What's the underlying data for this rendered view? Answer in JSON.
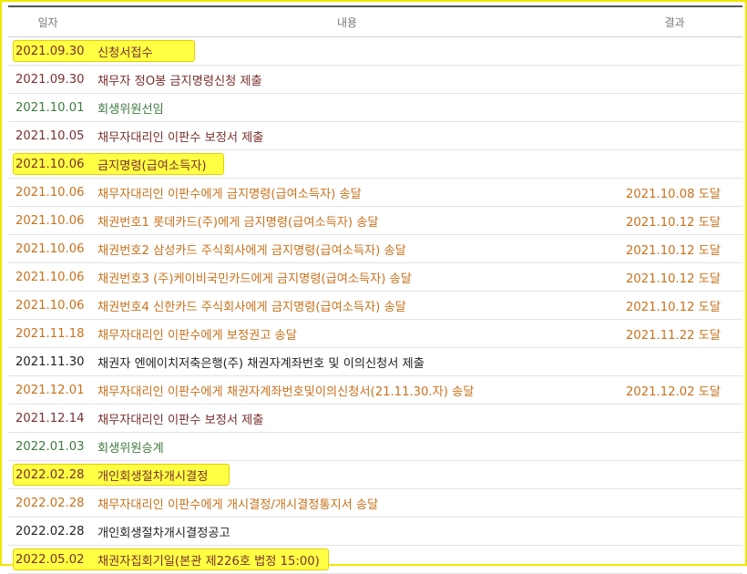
{
  "header": {
    "date": "일자",
    "content": "내용",
    "result": "결과"
  },
  "rows": [
    {
      "date": "2021.09.30",
      "content": "신청서접수",
      "result": "",
      "kind": "red",
      "hl_width": 198
    },
    {
      "date": "2021.09.30",
      "content": "채무자 정O봉 금지명령신청 제출",
      "result": "",
      "kind": "red"
    },
    {
      "date": "2021.10.01",
      "content": "회생위원선임",
      "result": "",
      "kind": "green"
    },
    {
      "date": "2021.10.05",
      "content": "채무자대리인 이판수 보정서 제출",
      "result": "",
      "kind": "red"
    },
    {
      "date": "2021.10.06",
      "content": "금지명령(급여소득자)",
      "result": "",
      "kind": "red",
      "hl_width": 230
    },
    {
      "date": "2021.10.06",
      "content": "채무자대리인 이판수에게 금지명령(급여소득자) 송달",
      "result": "2021.10.08 도달",
      "kind": "orange"
    },
    {
      "date": "2021.10.06",
      "content": "채권번호1 롯데카드(주)에게 금지명령(급여소득자) 송달",
      "result": "2021.10.12 도달",
      "kind": "orange"
    },
    {
      "date": "2021.10.06",
      "content": "채권번호2 삼성카드 주식회사에게 금지명령(급여소득자) 송달",
      "result": "2021.10.12 도달",
      "kind": "orange"
    },
    {
      "date": "2021.10.06",
      "content": "채권번호3 (주)케이비국민카드에게 금지명령(급여소득자) 송달",
      "result": "2021.10.12 도달",
      "kind": "orange"
    },
    {
      "date": "2021.10.06",
      "content": "채권번호4 신한카드 주식회사에게 금지명령(급여소득자) 송달",
      "result": "2021.10.12 도달",
      "kind": "orange"
    },
    {
      "date": "2021.11.18",
      "content": "채무자대리인 이판수에게 보정권고 송달",
      "result": "2021.11.22 도달",
      "kind": "orange"
    },
    {
      "date": "2021.11.30",
      "content": "채권자 엔에이치저축은행(주) 채권자계좌번호 및 이의신청서 제출",
      "result": "",
      "kind": "black"
    },
    {
      "date": "2021.12.01",
      "content": "채무자대리인 이판수에게 채권자계좌번호및이의신청서(21.11.30.자) 송달",
      "result": "2021.12.02 도달",
      "kind": "orange"
    },
    {
      "date": "2021.12.14",
      "content": "채무자대리인 이판수 보정서 제출",
      "result": "",
      "kind": "red"
    },
    {
      "date": "2022.01.03",
      "content": "회생위원승계",
      "result": "",
      "kind": "green"
    },
    {
      "date": "2022.02.28",
      "content": "개인회생절차개시결정",
      "result": "",
      "kind": "red",
      "hl_width": 236
    },
    {
      "date": "2022.02.28",
      "content": "채무자대리인 이판수에게 개시결정/개시결정통지서 송달",
      "result": "",
      "kind": "orange"
    },
    {
      "date": "2022.02.28",
      "content": "개인회생절차개시결정공고",
      "result": "",
      "kind": "black"
    },
    {
      "date": "2022.05.02",
      "content": "채권자집회기일(본관 제226호 법정 15:00)",
      "result": "",
      "kind": "red",
      "hl_width": 345
    }
  ],
  "colors": {
    "frame": "#f2e600",
    "highlight": "#ffff44",
    "orange": "#c8711b",
    "red": "#7a2f2f",
    "green": "#3f7a3f"
  }
}
